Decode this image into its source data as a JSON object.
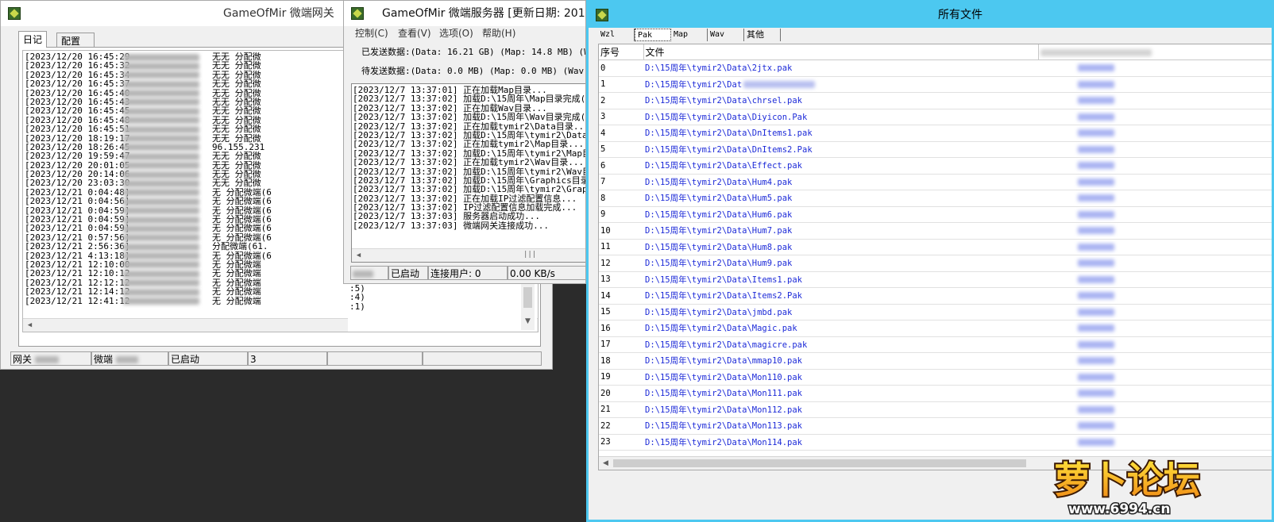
{
  "gateway_window": {
    "title": "GameOfMir 微端网关",
    "tabs": [
      "日记",
      "配置"
    ],
    "log_lines": [
      {
        "time": "[2023/12/20 16:45:29",
        "msg": "无无 分配微"
      },
      {
        "time": "[2023/12/20 16:45:32",
        "msg": "无无 分配微"
      },
      {
        "time": "[2023/12/20 16:45:34",
        "msg": "无无 分配微"
      },
      {
        "time": "[2023/12/20 16:45:37",
        "msg": "无无 分配微"
      },
      {
        "time": "[2023/12/20 16:45:40",
        "msg": "无无 分配微"
      },
      {
        "time": "[2023/12/20 16:45:43",
        "msg": "无无 分配微"
      },
      {
        "time": "[2023/12/20 16:45:45",
        "msg": "无无 分配微"
      },
      {
        "time": "[2023/12/20 16:45:48",
        "msg": "无无 分配微"
      },
      {
        "time": "[2023/12/20 16:45:51",
        "msg": "无无 分配微"
      },
      {
        "time": "[2023/12/20 18:19:17",
        "msg": "无无 分配微"
      },
      {
        "time": "[2023/12/20 18:26:45",
        "msg": "96.155.231"
      },
      {
        "time": "[2023/12/20 19:59:47",
        "msg": "无无 分配微"
      },
      {
        "time": "[2023/12/20 20:01:05",
        "msg": "无无 分配微"
      },
      {
        "time": "[2023/12/20 20:14:06",
        "msg": "无无 分配微"
      },
      {
        "time": "[2023/12/20 23:03:30",
        "msg": "无无 分配微"
      },
      {
        "time": "[2023/12/21 0:04:48]",
        "msg": "无 分配微端(6"
      },
      {
        "time": "[2023/12/21 0:04:56]",
        "msg": "无 分配微端(6"
      },
      {
        "time": "[2023/12/21 0:04:59]",
        "msg": "无 分配微端(6"
      },
      {
        "time": "[2023/12/21 0:04:59]",
        "msg": "无 分配微端(6"
      },
      {
        "time": "[2023/12/21 0:04:59]",
        "msg": "无 分配微端(6"
      },
      {
        "time": "[2023/12/21 0:57:56]",
        "msg": "无 分配微端(6"
      },
      {
        "time": "[2023/12/21 2:56:36]",
        "msg": "分配微端(61."
      },
      {
        "time": "[2023/12/21 4:13:18]",
        "msg": "无 分配微端(6"
      },
      {
        "time": "[2023/12/21 12:10:00",
        "msg": "无 分配微端"
      },
      {
        "time": "[2023/12/21 12:10:12",
        "msg": "无 分配微端"
      },
      {
        "time": "[2023/12/21 12:12:12",
        "msg": "无 分配微端"
      },
      {
        "time": "[2023/12/21 12:14:12",
        "msg": "无 分配微端"
      },
      {
        "time": "[2023/12/21 12:41:12",
        "msg": "无 分配微端"
      }
    ],
    "status": {
      "gateway": "网关",
      "micro": "微端",
      "state": "已启动",
      "count": "3"
    }
  },
  "server_window": {
    "title": "GameOfMir 微端服务器 [更新日期: 201",
    "menu": [
      "控制(C)",
      "查看(V)",
      "选项(O)",
      "帮助(H)"
    ],
    "sent_label": "已发送数据:(Data: 16.21 GB) (Map: 14.8 MB) (Wav:",
    "pending_label": "待发送数据:(Data: 0.0 MB) (Map: 0.0 MB) (Wav: 0.0",
    "log_lines": [
      "[2023/12/7 13:37:01] 正在加载Map目录...",
      "[2023/12/7 13:37:02] 加载D:\\15周年\\Map目录完成(937)",
      "[2023/12/7 13:37:02] 正在加载Wav目录...",
      "[2023/12/7 13:37:02] 加载D:\\15周年\\Wav目录完成(783)",
      "[2023/12/7 13:37:02] 正在加载tymir2\\Data目录...",
      "[2023/12/7 13:37:02] 加载D:\\15周年\\tymir2\\Data目录完",
      "[2023/12/7 13:37:02] 正在加载tymir2\\Map目录...",
      "[2023/12/7 13:37:02] 加载D:\\15周年\\tymir2\\Map目录完",
      "[2023/12/7 13:37:02] 正在加载tymir2\\Wav目录...",
      "[2023/12/7 13:37:02] 加载D:\\15周年\\tymir2\\Wav目录完",
      "[2023/12/7 13:37:02] 加载D:\\15周年\\Graphics目录完成",
      "[2023/12/7 13:37:02] 加载D:\\15周年\\tymir2\\Graphics\\",
      "[2023/12/7 13:37:02] 正在加载IP过滤配置信息...",
      "[2023/12/7 13:37:02] IP过滤配置信息加载完成...",
      "[2023/12/7 13:37:03] 服务器启动成功...",
      "[2023/12/7 13:37:03] 微端网关连接成功..."
    ],
    "status": {
      "state": "已启动",
      "users": "连接用户: 0",
      "speed": "0.00 KB/s"
    },
    "behind_tail": [
      ":5)",
      ":4)",
      ":1)"
    ]
  },
  "files_window": {
    "title": "所有文件",
    "tabs": [
      "Wzl",
      "Pak",
      "Map",
      "Wav",
      "其他"
    ],
    "active_tab": "Pak",
    "columns": [
      "序号",
      "文件"
    ],
    "rows": [
      {
        "idx": "0",
        "path": "D:\\15周年\\tymir2\\Data\\2jtx.pak"
      },
      {
        "idx": "1",
        "path": "D:\\15周年\\tymir2\\Dat"
      },
      {
        "idx": "2",
        "path": "D:\\15周年\\tymir2\\Data\\chrsel.pak"
      },
      {
        "idx": "3",
        "path": "D:\\15周年\\tymir2\\Data\\Diyicon.Pak"
      },
      {
        "idx": "4",
        "path": "D:\\15周年\\tymir2\\Data\\DnItems1.pak"
      },
      {
        "idx": "5",
        "path": "D:\\15周年\\tymir2\\Data\\DnItems2.Pak"
      },
      {
        "idx": "6",
        "path": "D:\\15周年\\tymir2\\Data\\Effect.pak"
      },
      {
        "idx": "7",
        "path": "D:\\15周年\\tymir2\\Data\\Hum4.pak"
      },
      {
        "idx": "8",
        "path": "D:\\15周年\\tymir2\\Data\\Hum5.pak"
      },
      {
        "idx": "9",
        "path": "D:\\15周年\\tymir2\\Data\\Hum6.pak"
      },
      {
        "idx": "10",
        "path": "D:\\15周年\\tymir2\\Data\\Hum7.pak"
      },
      {
        "idx": "11",
        "path": "D:\\15周年\\tymir2\\Data\\Hum8.pak"
      },
      {
        "idx": "12",
        "path": "D:\\15周年\\tymir2\\Data\\Hum9.pak"
      },
      {
        "idx": "13",
        "path": "D:\\15周年\\tymir2\\Data\\Items1.pak"
      },
      {
        "idx": "14",
        "path": "D:\\15周年\\tymir2\\Data\\Items2.Pak"
      },
      {
        "idx": "15",
        "path": "D:\\15周年\\tymir2\\Data\\jmbd.pak"
      },
      {
        "idx": "16",
        "path": "D:\\15周年\\tymir2\\Data\\Magic.pak"
      },
      {
        "idx": "17",
        "path": "D:\\15周年\\tymir2\\Data\\magicre.pak"
      },
      {
        "idx": "18",
        "path": "D:\\15周年\\tymir2\\Data\\mmap10.pak"
      },
      {
        "idx": "19",
        "path": "D:\\15周年\\tymir2\\Data\\Mon110.pak"
      },
      {
        "idx": "20",
        "path": "D:\\15周年\\tymir2\\Data\\Mon111.pak"
      },
      {
        "idx": "21",
        "path": "D:\\15周年\\tymir2\\Data\\Mon112.pak"
      },
      {
        "idx": "22",
        "path": "D:\\15周年\\tymir2\\Data\\Mon113.pak"
      },
      {
        "idx": "23",
        "path": "D:\\15周年\\tymir2\\Data\\Mon114.pak"
      }
    ]
  },
  "watermark": {
    "brand": "萝卜论坛",
    "url": "www.6994.cn"
  },
  "colors": {
    "accent_frame": "#4cc8f0",
    "path_text": "#1c2ad8",
    "brand_orange": "#f08a16",
    "brand_yellow": "#ffe23a"
  },
  "icons": {
    "app": "app-icon",
    "scroll_up": "scroll-up-icon",
    "scroll_down": "scroll-down-icon",
    "scroll_left": "scroll-left-icon",
    "scroll_right": "scroll-right-icon"
  }
}
